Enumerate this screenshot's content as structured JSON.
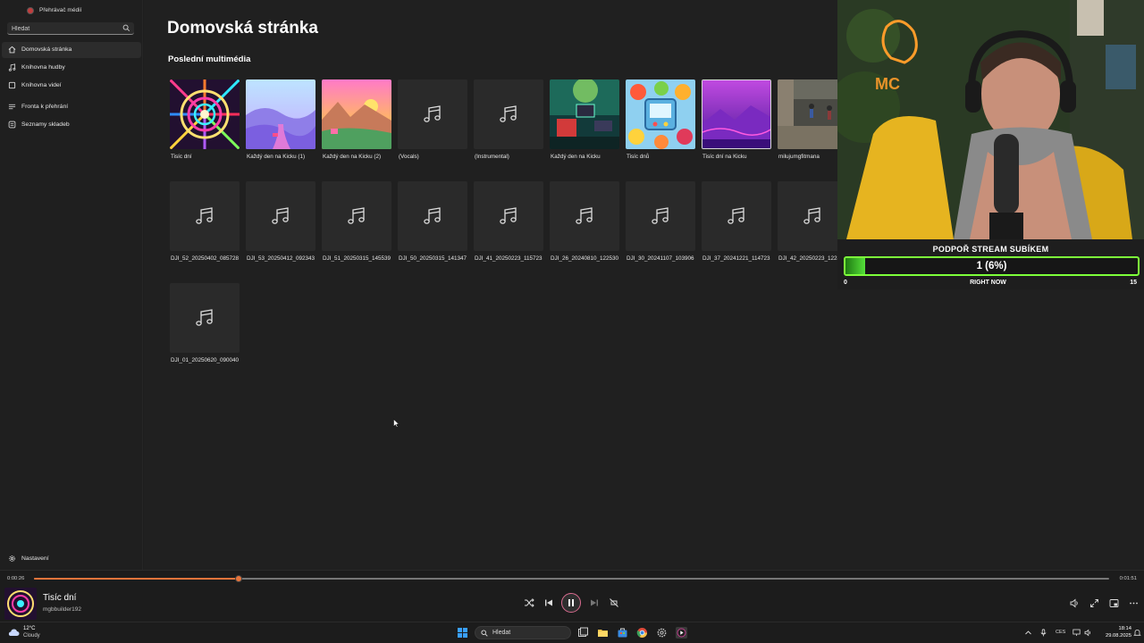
{
  "app": {
    "title": "Přehrávač médií"
  },
  "sidebar": {
    "search_placeholder": "Hledat",
    "items": [
      {
        "label": "Domovská stránka",
        "icon": "home-icon",
        "active": true
      },
      {
        "label": "Knihovna hudby",
        "icon": "music-library-icon",
        "active": false
      },
      {
        "label": "Knihovna videí",
        "icon": "video-library-icon",
        "active": false
      },
      {
        "label": "Fronta k přehrání",
        "icon": "queue-icon",
        "active": false
      },
      {
        "label": "Seznamy skladeb",
        "icon": "playlist-icon",
        "active": false
      }
    ],
    "settings_label": "Nastavení"
  },
  "main": {
    "page_title": "Domovská stránka",
    "section_title": "Poslední multimédia",
    "row1": [
      {
        "caption": "Tisíc dní",
        "thumb": "art-spiral"
      },
      {
        "caption": "Každý den na Kicku (1)",
        "thumb": "art-valley"
      },
      {
        "caption": "Každý den na Kicku (2)",
        "thumb": "art-sunset"
      },
      {
        "caption": "(Vocals)",
        "thumb": "music-note"
      },
      {
        "caption": "(Instrumental)",
        "thumb": "music-note"
      },
      {
        "caption": "Každý den na Kicku",
        "thumb": "art-room"
      },
      {
        "caption": "Tisíc dnů",
        "thumb": "art-fruit"
      },
      {
        "caption": "Tisíc dní na Kicku",
        "thumb": "art-purple"
      },
      {
        "caption": "milujumgfitmana",
        "thumb": "art-gym"
      }
    ],
    "row2": [
      {
        "caption": "DJI_52_20250402_085728"
      },
      {
        "caption": "DJI_53_20250412_092343"
      },
      {
        "caption": "DJI_51_20250315_145539"
      },
      {
        "caption": "DJI_50_20250315_141347"
      },
      {
        "caption": "DJI_41_20250223_115723"
      },
      {
        "caption": "DJI_26_20240810_122530"
      },
      {
        "caption": "DJI_30_20241107_103906"
      },
      {
        "caption": "DJI_37_20241221_114723"
      },
      {
        "caption": "DJI_42_20250223_122827"
      }
    ],
    "row3": [
      {
        "caption": "DJI_01_20250620_090040"
      }
    ]
  },
  "overlay": {
    "title": "PODPOŘ STREAM SUBÍKEM",
    "count_text": "1 (6%)",
    "progress_fraction": 0.067,
    "min": "0",
    "status": "RIGHT NOW",
    "max": "15"
  },
  "player": {
    "time_current": "0:00:26",
    "time_total": "0:01:51",
    "progress_fraction": 0.19,
    "track_title": "Tisíc dní",
    "track_artist": "mgbbuilder192"
  },
  "taskbar": {
    "temperature": "12°C",
    "weather": "Cloudy",
    "search_label": "Hledat",
    "language": "CES",
    "time": "18:14",
    "date": "29.08.2025"
  },
  "colors": {
    "accent": "#e8743b",
    "overlay_bar": "#7dff3a"
  }
}
